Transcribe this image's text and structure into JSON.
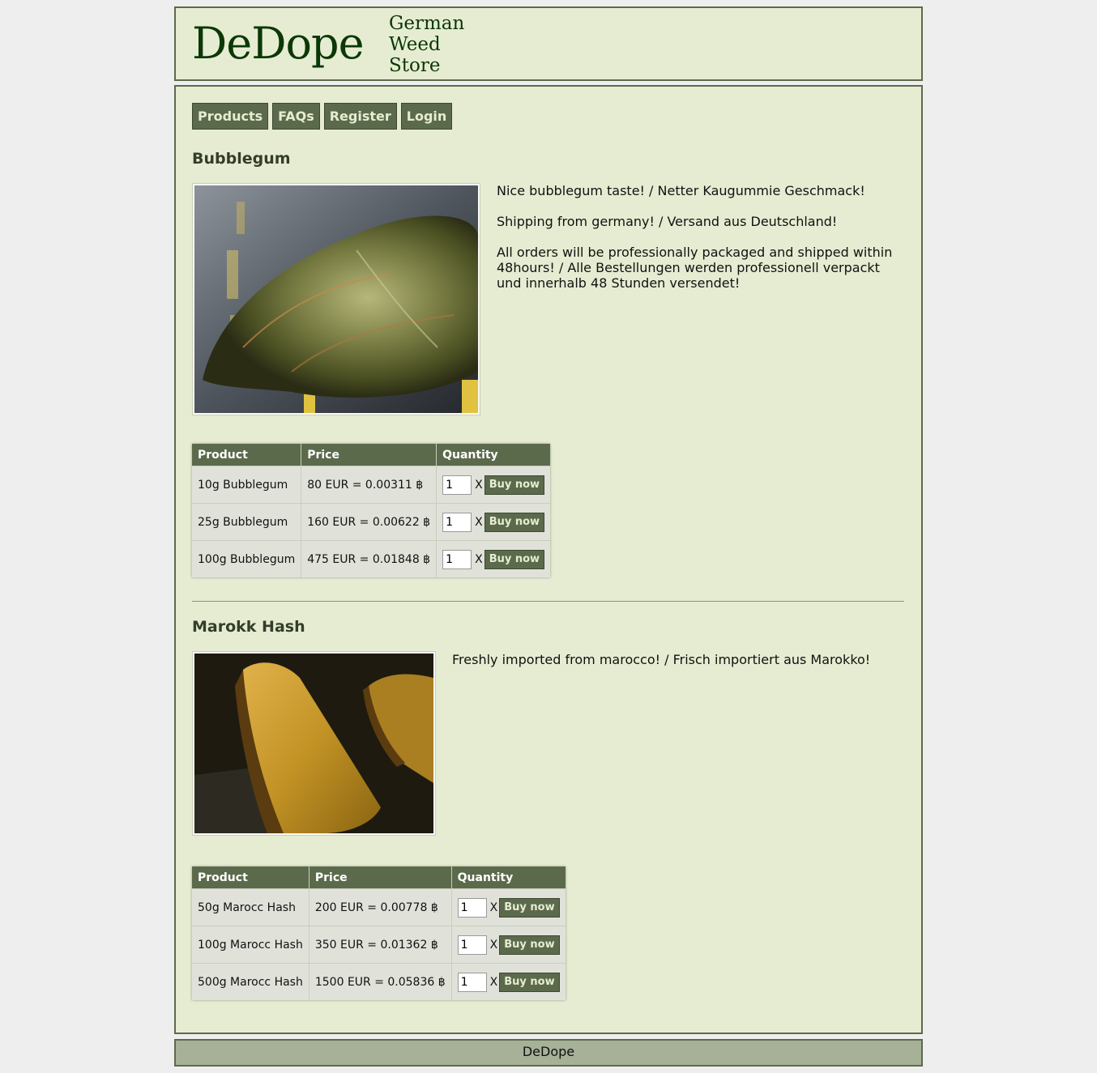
{
  "header": {
    "logo": "DeDope",
    "tagline": [
      "German",
      "Weed",
      "Store"
    ]
  },
  "nav": [
    {
      "label": "Products"
    },
    {
      "label": "FAQs"
    },
    {
      "label": "Register"
    },
    {
      "label": "Login"
    }
  ],
  "products": [
    {
      "title": "Bubblegum",
      "description": [
        "Nice bubblegum taste! / Netter Kaugummie Geschmack!",
        "Shipping from germany! / Versand aus Deutschland!",
        "All orders will be professionally packaged and shipped within 48hours! / Alle Bestellungen werden professionell verpackt und innerhalb 48 Stunden versendet!"
      ],
      "table_headers": [
        "Product",
        "Price",
        "Quantity"
      ],
      "rows": [
        {
          "product": "10g Bubblegum",
          "price": "80 EUR = 0.00311 ฿",
          "qty": "1",
          "x": "X",
          "buy": "Buy now"
        },
        {
          "product": "25g Bubblegum",
          "price": "160 EUR = 0.00622 ฿",
          "qty": "1",
          "x": "X",
          "buy": "Buy now"
        },
        {
          "product": "100g Bubblegum",
          "price": "475 EUR = 0.01848 ฿",
          "qty": "1",
          "x": "X",
          "buy": "Buy now"
        }
      ]
    },
    {
      "title": "Marokk Hash",
      "description": [
        "Freshly imported from marocco! / Frisch importiert aus Marokko!"
      ],
      "table_headers": [
        "Product",
        "Price",
        "Quantity"
      ],
      "rows": [
        {
          "product": "50g Marocc Hash",
          "price": "200 EUR = 0.00778 ฿",
          "qty": "1",
          "x": "X",
          "buy": "Buy now"
        },
        {
          "product": "100g Marocc Hash",
          "price": "350 EUR = 0.01362 ฿",
          "qty": "1",
          "x": "X",
          "buy": "Buy now"
        },
        {
          "product": "500g Marocc Hash",
          "price": "1500 EUR = 0.05836 ฿",
          "qty": "1",
          "x": "X",
          "buy": "Buy now"
        }
      ]
    }
  ],
  "footer": {
    "text": "DeDope"
  }
}
